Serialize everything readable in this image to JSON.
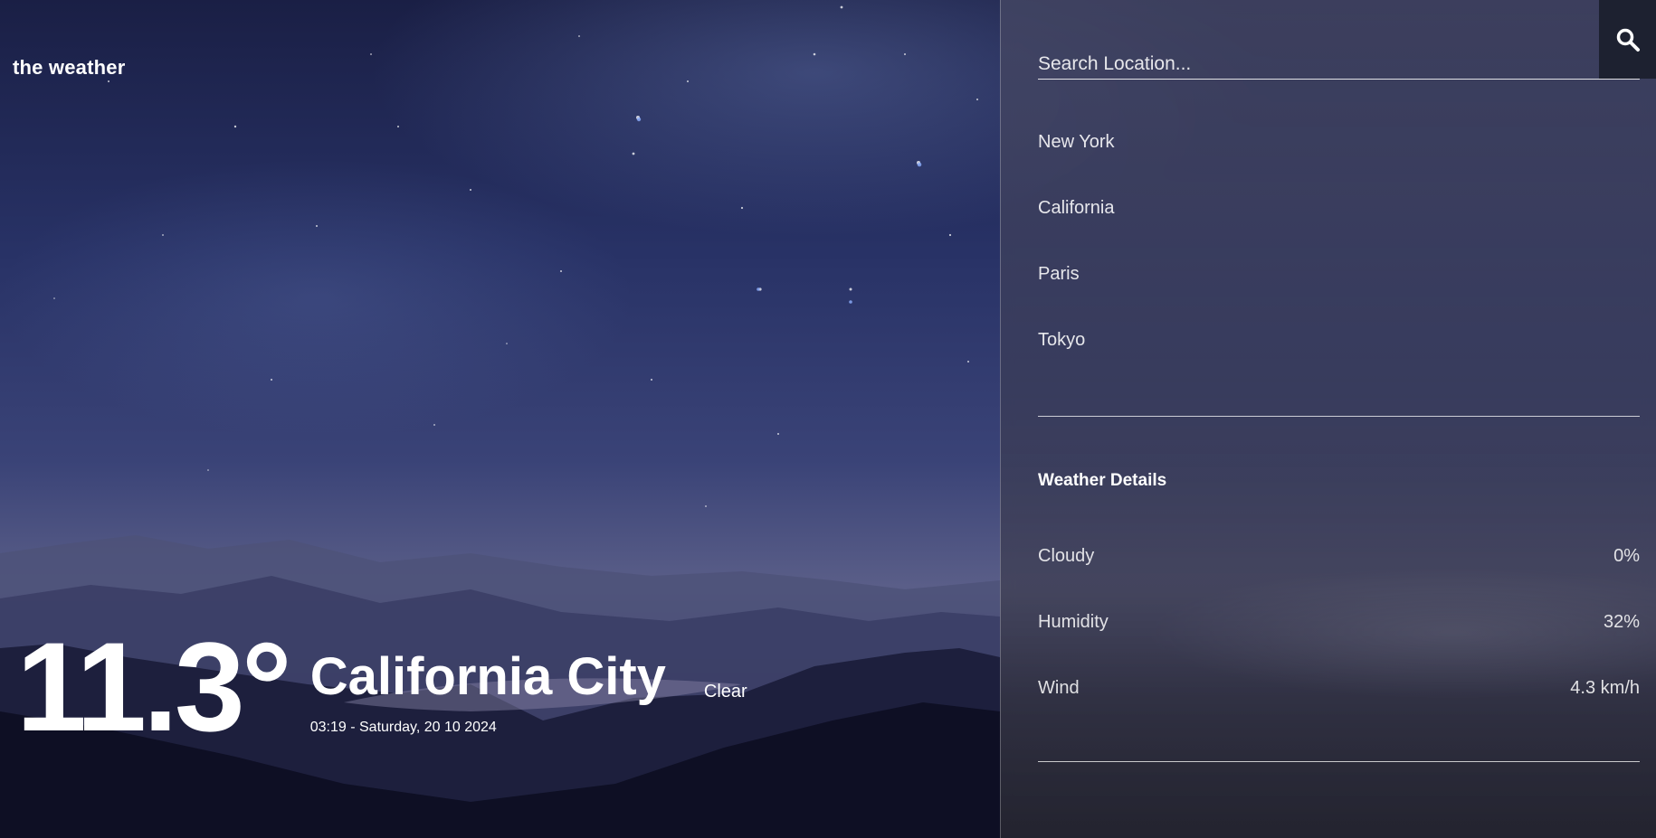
{
  "brand": {
    "title": "the weather"
  },
  "current": {
    "temperature": "11.3°",
    "city": "California City",
    "datetime": "03:19 - Saturday, 20 10 2024",
    "condition": "Clear"
  },
  "search": {
    "placeholder": "Search Location...",
    "value": "",
    "icon": "search-icon"
  },
  "locations": [
    "New York",
    "California",
    "Paris",
    "Tokyo"
  ],
  "details": {
    "title": "Weather Details",
    "rows": [
      {
        "label": "Cloudy",
        "value": "0%"
      },
      {
        "label": "Humidity",
        "value": "32%"
      },
      {
        "label": "Wind",
        "value": "4.3 km/h"
      }
    ]
  },
  "colors": {
    "panel": "#3e4060",
    "search_button": "#1d2130",
    "text": "#ffffff"
  }
}
